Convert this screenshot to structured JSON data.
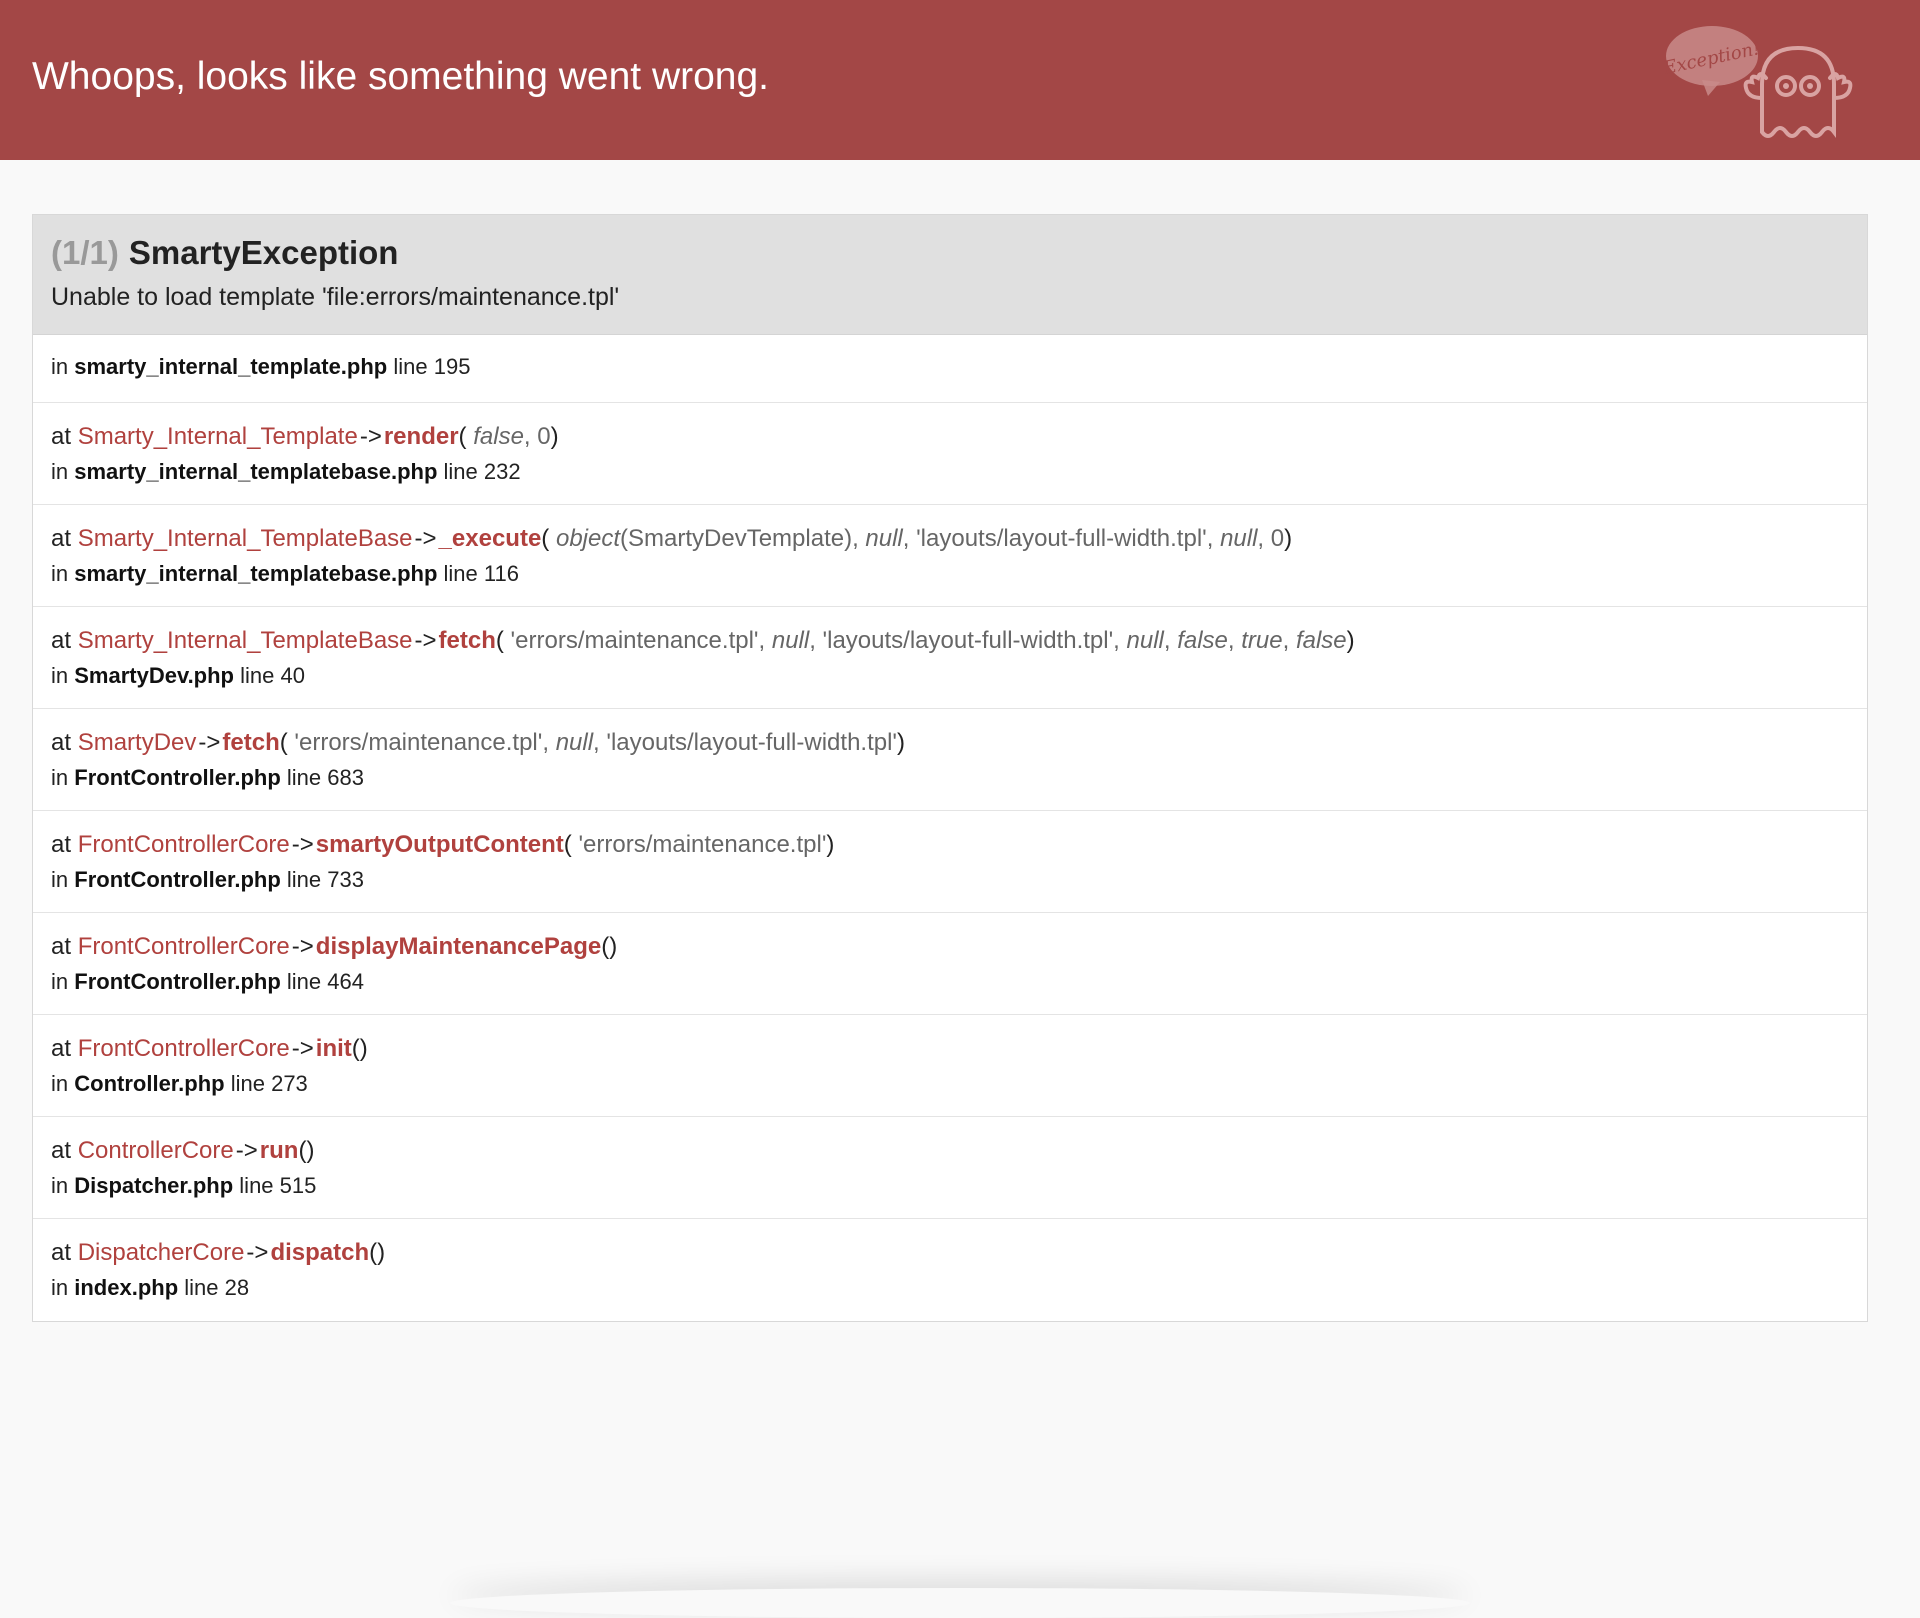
{
  "header": {
    "title": "Whoops, looks like something went wrong.",
    "logo_text": "Exception!"
  },
  "exception": {
    "counter": "(1/1)",
    "class": "SmartyException",
    "message": "Unable to load template 'file:errors/maintenance.tpl'"
  },
  "trace_first": {
    "prefix": "in",
    "file": "smarty_internal_template.php",
    "line_word": "line",
    "line": "195"
  },
  "trace": [
    {
      "at": "at",
      "class": "Smarty_Internal_Template",
      "arrow": "->",
      "method": "render",
      "open_paren": "(",
      "args": [
        {
          "text": " false",
          "italic": true
        },
        {
          "text": ", 0",
          "italic": false
        }
      ],
      "close_paren": ")",
      "in": "in",
      "file": "smarty_internal_templatebase.php",
      "line_word": "line",
      "line": "232"
    },
    {
      "at": "at",
      "class": "Smarty_Internal_TemplateBase",
      "arrow": "->",
      "method": "_execute",
      "open_paren": "(",
      "args": [
        {
          "text": " object",
          "italic": true
        },
        {
          "text": "(SmartyDevTemplate), ",
          "italic": false
        },
        {
          "text": "null",
          "italic": true
        },
        {
          "text": ", 'layouts/layout-full-width.tpl', ",
          "italic": false
        },
        {
          "text": "null",
          "italic": true
        },
        {
          "text": ", 0",
          "italic": false
        }
      ],
      "close_paren": ")",
      "in": "in",
      "file": "smarty_internal_templatebase.php",
      "line_word": "line",
      "line": "116"
    },
    {
      "at": "at",
      "class": "Smarty_Internal_TemplateBase",
      "arrow": "->",
      "method": "fetch",
      "open_paren": "(",
      "args": [
        {
          "text": " 'errors/maintenance.tpl', ",
          "italic": false
        },
        {
          "text": "null",
          "italic": true
        },
        {
          "text": ", 'layouts/layout-full-width.tpl', ",
          "italic": false
        },
        {
          "text": "null",
          "italic": true
        },
        {
          "text": ", ",
          "italic": false
        },
        {
          "text": "false",
          "italic": true
        },
        {
          "text": ", ",
          "italic": false
        },
        {
          "text": "true",
          "italic": true
        },
        {
          "text": ", ",
          "italic": false
        },
        {
          "text": "false",
          "italic": true
        }
      ],
      "close_paren": ")",
      "in": "in",
      "file": "SmartyDev.php",
      "line_word": "line",
      "line": "40"
    },
    {
      "at": "at",
      "class": "SmartyDev",
      "arrow": "->",
      "method": "fetch",
      "open_paren": "(",
      "args": [
        {
          "text": " 'errors/maintenance.tpl', ",
          "italic": false
        },
        {
          "text": "null",
          "italic": true
        },
        {
          "text": ", 'layouts/layout-full-width.tpl'",
          "italic": false
        }
      ],
      "close_paren": ")",
      "in": "in",
      "file": "FrontController.php",
      "line_word": "line",
      "line": "683"
    },
    {
      "at": "at",
      "class": "FrontControllerCore",
      "arrow": "->",
      "method": "smartyOutputContent",
      "open_paren": "(",
      "args": [
        {
          "text": " 'errors/maintenance.tpl'",
          "italic": false
        }
      ],
      "close_paren": ")",
      "in": "in",
      "file": "FrontController.php",
      "line_word": "line",
      "line": "733"
    },
    {
      "at": "at",
      "class": "FrontControllerCore",
      "arrow": "->",
      "method": "displayMaintenancePage",
      "open_paren": "(",
      "args": [],
      "close_paren": ")",
      "in": "in",
      "file": "FrontController.php",
      "line_word": "line",
      "line": "464"
    },
    {
      "at": "at",
      "class": "FrontControllerCore",
      "arrow": "->",
      "method": "init",
      "open_paren": "(",
      "args": [],
      "close_paren": ")",
      "in": "in",
      "file": "Controller.php",
      "line_word": "line",
      "line": "273"
    },
    {
      "at": "at",
      "class": "ControllerCore",
      "arrow": "->",
      "method": "run",
      "open_paren": "(",
      "args": [],
      "close_paren": ")",
      "in": "in",
      "file": "Dispatcher.php",
      "line_word": "line",
      "line": "515"
    },
    {
      "at": "at",
      "class": "DispatcherCore",
      "arrow": "->",
      "method": "dispatch",
      "open_paren": "(",
      "args": [],
      "close_paren": ")",
      "in": "in",
      "file": "index.php",
      "line_word": "line",
      "line": "28"
    }
  ],
  "colors": {
    "header_bg": "#a34746",
    "accent": "#b0413e",
    "page_bg": "#f9f9f9",
    "exception_header_bg": "#e0e0e0"
  },
  "icons": {
    "logo": "ghost-exception-icon"
  }
}
